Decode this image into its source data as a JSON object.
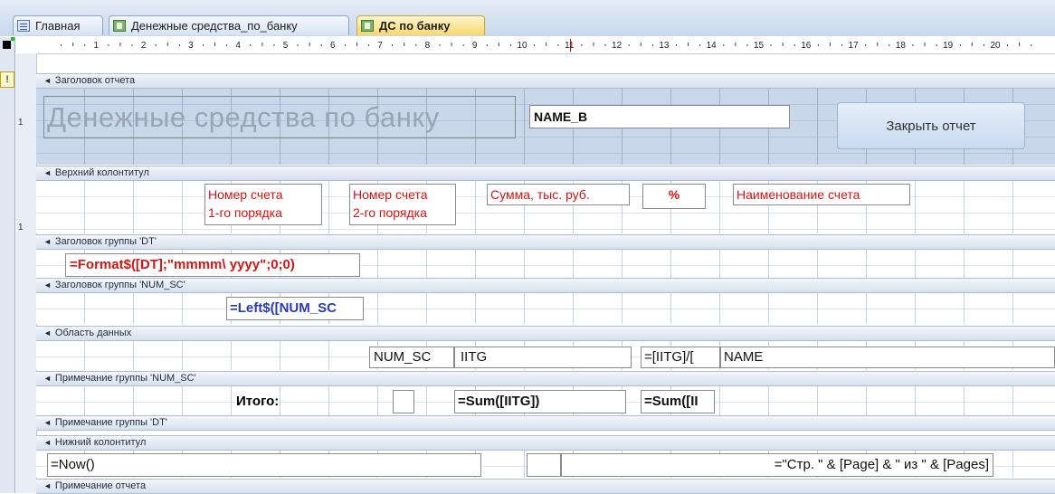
{
  "tabs": [
    {
      "label": "Главная",
      "icon": "form-icon"
    },
    {
      "label": "Денежные средства_по_банку",
      "icon": "report-icon"
    },
    {
      "label": "ДС по банку",
      "icon": "report-icon",
      "active": true
    }
  ],
  "ruler": {
    "numbers": [
      "1",
      "2",
      "3",
      "4",
      "5",
      "6",
      "7",
      "8",
      "9",
      "10",
      "11",
      "12",
      "13",
      "14",
      "15",
      "16",
      "17",
      "18",
      "19",
      "20"
    ]
  },
  "vruler": {
    "one": "1",
    "one2": "1"
  },
  "sections": {
    "report_header": "Заголовок отчета",
    "page_header": "Верхний колонтитул",
    "group_dt": "Заголовок группы 'DT'",
    "group_num_sc": "Заголовок группы 'NUM_SC'",
    "detail": "Область данных",
    "footer_num_sc": "Примечание группы 'NUM_SC'",
    "footer_dt": "Примечание группы 'DT'",
    "page_footer": "Нижний колонтитул",
    "report_footer": "Примечание отчета"
  },
  "report_header": {
    "title": "Денежные средства по банку",
    "name_b": "NAME_B",
    "close_button": "Закрыть отчет"
  },
  "page_header": {
    "account1_line1": "Номер счета",
    "account1_line2": "1-го порядка",
    "account2_line1": "Номер счета",
    "account2_line2": "2-го порядка",
    "sum": "Сумма, тыс. руб.",
    "percent": "%",
    "account_name": "Наименование счета"
  },
  "group_dt": {
    "expr": "=Format$([DT];\"mmmm\\ yyyy\";0;0)"
  },
  "group_num_sc": {
    "expr": "=Left$([NUM_SC"
  },
  "detail": {
    "num_sc": "NUM_SC",
    "iitg": "IITG",
    "ratio": "=[IITG]/[",
    "name": "NAME"
  },
  "footer_num_sc": {
    "total_label": "Итого:",
    "sum_expr": "=Sum([IITG])",
    "sum2_expr": "=Sum([II"
  },
  "page_footer": {
    "now": "=Now()",
    "pages": "=\"Стр. \" & [Page] & \" из \" & [Pages]"
  },
  "colors": {
    "label_red": "#d21414",
    "expr_blue": "#2a39b8",
    "header_fill": "#c8d7ea"
  }
}
